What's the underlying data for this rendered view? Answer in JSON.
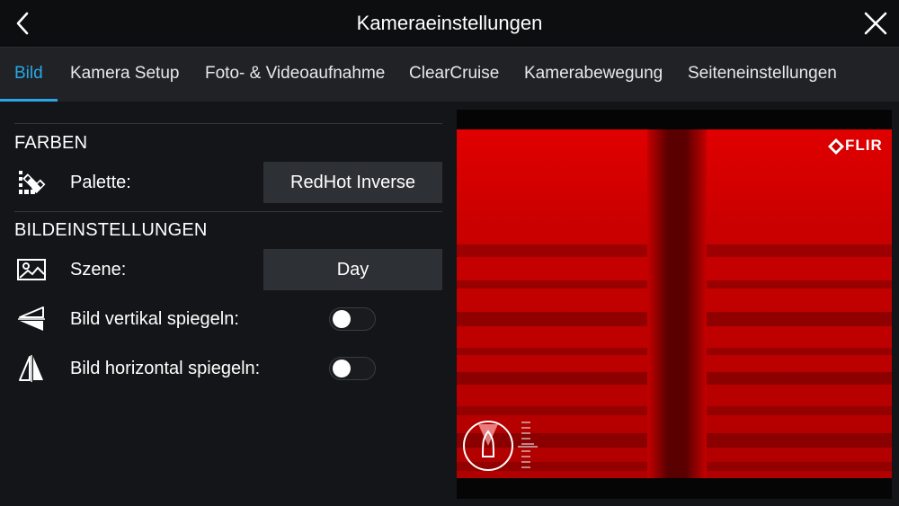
{
  "header": {
    "title": "Kameraeinstellungen",
    "back_icon": "chevron-left-icon",
    "close_icon": "close-icon"
  },
  "tabs": [
    {
      "label": "Bild",
      "active": true
    },
    {
      "label": "Kamera Setup",
      "active": false
    },
    {
      "label": "Foto- & Videoaufnahme",
      "active": false
    },
    {
      "label": "ClearCruise",
      "active": false
    },
    {
      "label": "Kamerabewegung",
      "active": false
    },
    {
      "label": "Seiteneinstellungen",
      "active": false
    }
  ],
  "sections": {
    "colors": {
      "title": "FARBEN",
      "palette_label": "Palette:",
      "palette_value": "RedHot Inverse"
    },
    "image": {
      "title": "BILDEINSTELLUNGEN",
      "scene_label": "Szene:",
      "scene_value": "Day",
      "flip_vertical_label": "Bild vertikal spiegeln:",
      "flip_vertical_on": false,
      "flip_horizontal_label": "Bild horizontal spiegeln:",
      "flip_horizontal_on": false
    }
  },
  "preview": {
    "brand": "FLIR"
  },
  "colors": {
    "accent": "#2aa7e8",
    "background": "#141518",
    "header": "#0d0e10",
    "tabbar": "#202226",
    "button": "#2d3035",
    "thermal_red": "#c80000"
  }
}
